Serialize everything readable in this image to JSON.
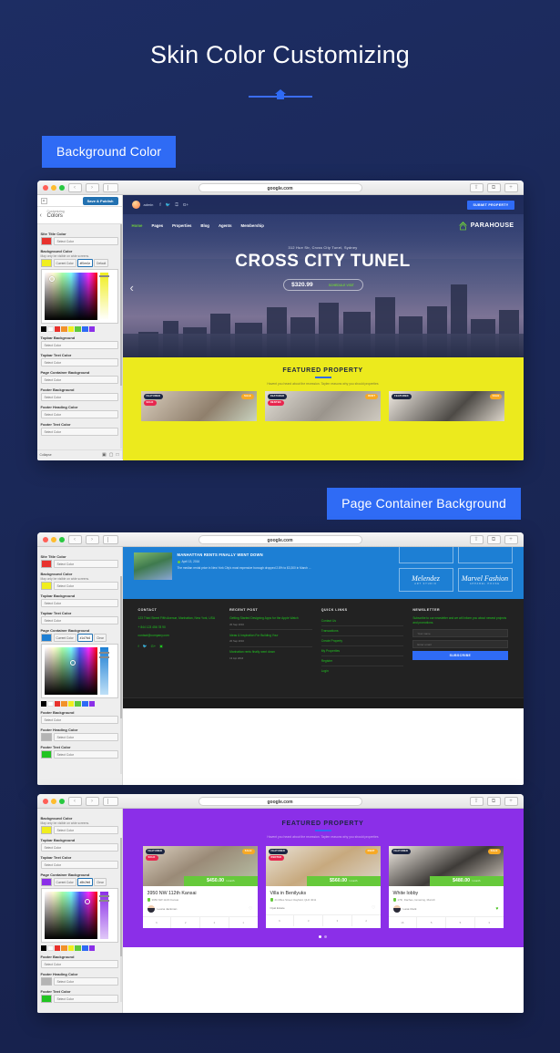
{
  "header": {
    "title": "Skin Color Customizing",
    "divider_icon": "house-divider-icon"
  },
  "badges": {
    "background_color": "Background Color",
    "page_container_background": "Page Container Background"
  },
  "browser": {
    "url": "google.com",
    "back_icon": "‹",
    "forward_icon": "›",
    "share_icon": "⇧",
    "tabs_icon": "⧉",
    "newtab_icon": "+"
  },
  "customizer": {
    "close_icon": "×",
    "publish_label": "Save & Publish",
    "breadcrumb": "Customizing",
    "panel_title": "Colors",
    "back_icon": "‹",
    "collapse_label": "Collapse",
    "select_color": "Select Color",
    "current_color": "Current Color",
    "default_label": "Default",
    "clear_label": "Clear",
    "controls": {
      "site_title_color": {
        "label": "Site Title Color",
        "swatch": "#e8322d"
      },
      "background_color": {
        "label": "Background Color",
        "desc": "May only be visible on wide screens.",
        "swatch": "#f0ee1e",
        "hex": "#f0ee1e"
      },
      "topbar_background": {
        "label": "Topbar Background",
        "swatch": "#ffffff"
      },
      "topbar_text_color": {
        "label": "Topbar Text Color",
        "swatch": "#ffffff"
      },
      "page_container_background": {
        "label": "Page Container Background",
        "swatch_w2": "#1d7fd4",
        "hex_w2": "#1d7fd4",
        "swatch_w3": "#8b2fe8",
        "hex_w3": "#8b2fe8"
      },
      "footer_background": {
        "label": "Footer Background",
        "swatch": "#ffffff"
      },
      "footer_heading_color": {
        "label": "Footer Heading Color",
        "swatch": "#b4b4b4"
      },
      "footer_text_color": {
        "label": "Footer Text Color",
        "swatch": "#21c421"
      }
    },
    "swatch_row": [
      "#000000",
      "#ffffff",
      "#e8322d",
      "#f2922a",
      "#f0ee1e",
      "#5ec83c",
      "#2f6bf5",
      "#8b2fe8"
    ]
  },
  "site1": {
    "topbar": {
      "user": "admin",
      "social": [
        "f",
        "ᵛ",
        "⚲",
        "G+"
      ],
      "submit_label": "SUBMIT PROPERTY"
    },
    "nav": [
      "Home",
      "Pages",
      "Properties",
      "Blog",
      "Agents",
      "Membership"
    ],
    "logo": "PARAHOUSE",
    "hero": {
      "subtitle": "312 Hue Str, Cross City Tunel, Sydney",
      "title": "CROSS CITY TUNEL",
      "price": "$320.99",
      "cta": "SCHEDULE VISIT",
      "prev_icon": "‹"
    },
    "featured": {
      "title": "FEATURED PROPERTY",
      "subtitle": "Havent you heard about the recession. Taylen reasons why you should properties",
      "cards": [
        {
          "feat": "FEATURED",
          "status": "SOLD",
          "deal": "SALE"
        },
        {
          "feat": "FEATURED",
          "status": "RENTED",
          "deal": "RENT"
        },
        {
          "feat": "FEATURED",
          "status": "",
          "deal": "SALE"
        }
      ]
    }
  },
  "site2": {
    "blog": {
      "title": "MANHATTAN RENTS FINALLY WENT DOWN",
      "date": "April 13, 2016",
      "excerpt": "The median rental price in New York City's most expensive borough dropped 2.8% to $3,300 in March ..."
    },
    "brands": [
      {
        "name": "Melendez",
        "sub": "ART STUDIO"
      },
      {
        "name": "Marvel Fashion",
        "sub": "APPAREL HOUSE"
      }
    ],
    "footer": {
      "contact": {
        "heading": "CONTACT",
        "address": "123 Third Street Fifth Avenue, Manhattan, New York, USA",
        "phone": "+ 844 123 456 78 90",
        "email": "contact@company.com",
        "social": [
          "f",
          "ᵛ",
          "G+",
          "▣"
        ]
      },
      "recent": {
        "heading": "RECENT POST",
        "posts": [
          {
            "title": "Getting Started Designing Apps for the Apple Watch",
            "date": "20 Sep 2016"
          },
          {
            "title": "Ideas & Inspiration For Building Your",
            "date": "20 Sep 2016"
          },
          {
            "title": "Manhattan rents finally went down",
            "date": "13 Apr 2016"
          }
        ]
      },
      "quick": {
        "heading": "QUICK LINKS",
        "links": [
          "Contact Us",
          "Transactions",
          "Create Property",
          "My Properties",
          "Register",
          "Login"
        ]
      },
      "newsletter": {
        "heading": "NEWSLETTER",
        "text": "Subscribe to our newsletter and we will inform you about newest projects and promotions.",
        "name_placeholder": "Your name",
        "email_placeholder": "Enter email",
        "button": "SUBSCRIBE"
      }
    }
  },
  "site3": {
    "featured": {
      "title": "FEATURED PROPERTY",
      "subtitle": "Havent you heard about the recession. Taylen reasons why you should properties"
    },
    "cards": [
      {
        "feat": "FEATURED",
        "status": "SOLD",
        "deal": "SALE",
        "price": "$450.00",
        "period": "/ month",
        "name": "3950 NW 112th Kansai",
        "address": "3950 NW 112th Kansai",
        "agent": "Leona Jackman",
        "specs": [
          "6",
          "2",
          "2",
          "1"
        ],
        "liked": false
      },
      {
        "feat": "FEATURED",
        "status": "RENTED",
        "deal": "RENT",
        "price": "$560.00",
        "period": "/ month",
        "name": "Villa in Benilyuks",
        "address": "21 Miles Street Clayfield, QLD 4011",
        "agent": "Opal Estate",
        "specs": [
          "6",
          "3",
          "3",
          "2"
        ],
        "liked": false
      },
      {
        "feat": "FEATURED",
        "status": "",
        "deal": "SALE",
        "price": "$480.00",
        "period": "/ month",
        "name": "White lobby",
        "address": "17th, Dachau, Ismaning, Munich",
        "agent": "Lana Clark",
        "specs": [
          "16",
          "5",
          "5",
          "3"
        ],
        "liked": true
      }
    ]
  },
  "colors": {
    "page_bg": "#1b2a5c",
    "accent": "#2f6bf5",
    "yellow": "#ecea1d",
    "blue_container": "#1d7fd4",
    "purple_container": "#8b2fe8",
    "green": "#66c93b"
  }
}
